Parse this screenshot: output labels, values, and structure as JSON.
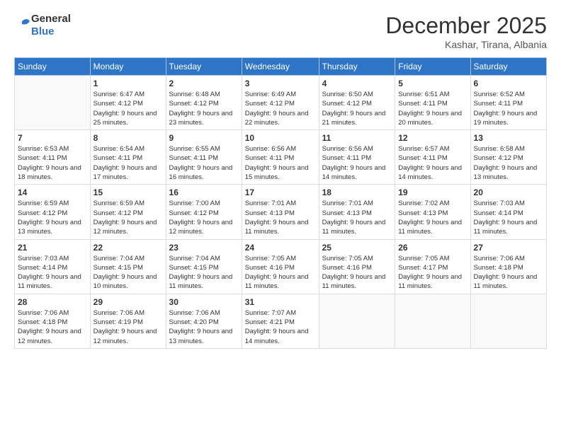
{
  "header": {
    "logo_general": "General",
    "logo_blue": "Blue",
    "month_title": "December 2025",
    "subtitle": "Kashar, Tirana, Albania"
  },
  "days_of_week": [
    "Sunday",
    "Monday",
    "Tuesday",
    "Wednesday",
    "Thursday",
    "Friday",
    "Saturday"
  ],
  "weeks": [
    [
      {
        "day": "",
        "empty": true
      },
      {
        "day": "1",
        "sunrise": "Sunrise: 6:47 AM",
        "sunset": "Sunset: 4:12 PM",
        "daylight": "Daylight: 9 hours and 25 minutes."
      },
      {
        "day": "2",
        "sunrise": "Sunrise: 6:48 AM",
        "sunset": "Sunset: 4:12 PM",
        "daylight": "Daylight: 9 hours and 23 minutes."
      },
      {
        "day": "3",
        "sunrise": "Sunrise: 6:49 AM",
        "sunset": "Sunset: 4:12 PM",
        "daylight": "Daylight: 9 hours and 22 minutes."
      },
      {
        "day": "4",
        "sunrise": "Sunrise: 6:50 AM",
        "sunset": "Sunset: 4:12 PM",
        "daylight": "Daylight: 9 hours and 21 minutes."
      },
      {
        "day": "5",
        "sunrise": "Sunrise: 6:51 AM",
        "sunset": "Sunset: 4:11 PM",
        "daylight": "Daylight: 9 hours and 20 minutes."
      },
      {
        "day": "6",
        "sunrise": "Sunrise: 6:52 AM",
        "sunset": "Sunset: 4:11 PM",
        "daylight": "Daylight: 9 hours and 19 minutes."
      }
    ],
    [
      {
        "day": "7",
        "sunrise": "Sunrise: 6:53 AM",
        "sunset": "Sunset: 4:11 PM",
        "daylight": "Daylight: 9 hours and 18 minutes."
      },
      {
        "day": "8",
        "sunrise": "Sunrise: 6:54 AM",
        "sunset": "Sunset: 4:11 PM",
        "daylight": "Daylight: 9 hours and 17 minutes."
      },
      {
        "day": "9",
        "sunrise": "Sunrise: 6:55 AM",
        "sunset": "Sunset: 4:11 PM",
        "daylight": "Daylight: 9 hours and 16 minutes."
      },
      {
        "day": "10",
        "sunrise": "Sunrise: 6:56 AM",
        "sunset": "Sunset: 4:11 PM",
        "daylight": "Daylight: 9 hours and 15 minutes."
      },
      {
        "day": "11",
        "sunrise": "Sunrise: 6:56 AM",
        "sunset": "Sunset: 4:11 PM",
        "daylight": "Daylight: 9 hours and 14 minutes."
      },
      {
        "day": "12",
        "sunrise": "Sunrise: 6:57 AM",
        "sunset": "Sunset: 4:11 PM",
        "daylight": "Daylight: 9 hours and 14 minutes."
      },
      {
        "day": "13",
        "sunrise": "Sunrise: 6:58 AM",
        "sunset": "Sunset: 4:12 PM",
        "daylight": "Daylight: 9 hours and 13 minutes."
      }
    ],
    [
      {
        "day": "14",
        "sunrise": "Sunrise: 6:59 AM",
        "sunset": "Sunset: 4:12 PM",
        "daylight": "Daylight: 9 hours and 13 minutes."
      },
      {
        "day": "15",
        "sunrise": "Sunrise: 6:59 AM",
        "sunset": "Sunset: 4:12 PM",
        "daylight": "Daylight: 9 hours and 12 minutes."
      },
      {
        "day": "16",
        "sunrise": "Sunrise: 7:00 AM",
        "sunset": "Sunset: 4:12 PM",
        "daylight": "Daylight: 9 hours and 12 minutes."
      },
      {
        "day": "17",
        "sunrise": "Sunrise: 7:01 AM",
        "sunset": "Sunset: 4:13 PM",
        "daylight": "Daylight: 9 hours and 11 minutes."
      },
      {
        "day": "18",
        "sunrise": "Sunrise: 7:01 AM",
        "sunset": "Sunset: 4:13 PM",
        "daylight": "Daylight: 9 hours and 11 minutes."
      },
      {
        "day": "19",
        "sunrise": "Sunrise: 7:02 AM",
        "sunset": "Sunset: 4:13 PM",
        "daylight": "Daylight: 9 hours and 11 minutes."
      },
      {
        "day": "20",
        "sunrise": "Sunrise: 7:03 AM",
        "sunset": "Sunset: 4:14 PM",
        "daylight": "Daylight: 9 hours and 11 minutes."
      }
    ],
    [
      {
        "day": "21",
        "sunrise": "Sunrise: 7:03 AM",
        "sunset": "Sunset: 4:14 PM",
        "daylight": "Daylight: 9 hours and 11 minutes."
      },
      {
        "day": "22",
        "sunrise": "Sunrise: 7:04 AM",
        "sunset": "Sunset: 4:15 PM",
        "daylight": "Daylight: 9 hours and 10 minutes."
      },
      {
        "day": "23",
        "sunrise": "Sunrise: 7:04 AM",
        "sunset": "Sunset: 4:15 PM",
        "daylight": "Daylight: 9 hours and 11 minutes."
      },
      {
        "day": "24",
        "sunrise": "Sunrise: 7:05 AM",
        "sunset": "Sunset: 4:16 PM",
        "daylight": "Daylight: 9 hours and 11 minutes."
      },
      {
        "day": "25",
        "sunrise": "Sunrise: 7:05 AM",
        "sunset": "Sunset: 4:16 PM",
        "daylight": "Daylight: 9 hours and 11 minutes."
      },
      {
        "day": "26",
        "sunrise": "Sunrise: 7:05 AM",
        "sunset": "Sunset: 4:17 PM",
        "daylight": "Daylight: 9 hours and 11 minutes."
      },
      {
        "day": "27",
        "sunrise": "Sunrise: 7:06 AM",
        "sunset": "Sunset: 4:18 PM",
        "daylight": "Daylight: 9 hours and 11 minutes."
      }
    ],
    [
      {
        "day": "28",
        "sunrise": "Sunrise: 7:06 AM",
        "sunset": "Sunset: 4:18 PM",
        "daylight": "Daylight: 9 hours and 12 minutes."
      },
      {
        "day": "29",
        "sunrise": "Sunrise: 7:06 AM",
        "sunset": "Sunset: 4:19 PM",
        "daylight": "Daylight: 9 hours and 12 minutes."
      },
      {
        "day": "30",
        "sunrise": "Sunrise: 7:06 AM",
        "sunset": "Sunset: 4:20 PM",
        "daylight": "Daylight: 9 hours and 13 minutes."
      },
      {
        "day": "31",
        "sunrise": "Sunrise: 7:07 AM",
        "sunset": "Sunset: 4:21 PM",
        "daylight": "Daylight: 9 hours and 14 minutes."
      },
      {
        "day": "",
        "empty": true
      },
      {
        "day": "",
        "empty": true
      },
      {
        "day": "",
        "empty": true
      }
    ]
  ]
}
